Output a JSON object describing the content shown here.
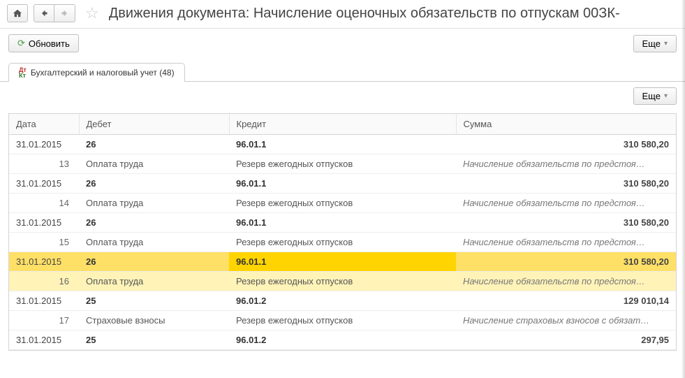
{
  "header": {
    "title": "Движения документа: Начисление оценочных обязательств по отпускам 00ЗК-"
  },
  "toolbar": {
    "refresh_label": "Обновить",
    "more_label": "Еще"
  },
  "tabs": {
    "accounting_label": "Бухгалтерский и налоговый учет (48)"
  },
  "sub_toolbar": {
    "more_label": "Еще"
  },
  "table": {
    "columns": {
      "date": "Дата",
      "debit": "Дебет",
      "credit": "Кредит",
      "sum": "Сумма"
    },
    "rows": [
      {
        "date": "31.01.2015",
        "debit": "26",
        "credit": "96.01.1",
        "sum": "310 580,20",
        "seq": "13",
        "debit_desc": "Оплата труда",
        "credit_desc": "Резерв ежегодных отпусков",
        "note": "Начисление обязательств по предстоя…",
        "selected": false
      },
      {
        "date": "31.01.2015",
        "debit": "26",
        "credit": "96.01.1",
        "sum": "310 580,20",
        "seq": "14",
        "debit_desc": "Оплата труда",
        "credit_desc": "Резерв ежегодных отпусков",
        "note": "Начисление обязательств по предстоя…",
        "selected": false
      },
      {
        "date": "31.01.2015",
        "debit": "26",
        "credit": "96.01.1",
        "sum": "310 580,20",
        "seq": "15",
        "debit_desc": "Оплата труда",
        "credit_desc": "Резерв ежегодных отпусков",
        "note": "Начисление обязательств по предстоя…",
        "selected": false
      },
      {
        "date": "31.01.2015",
        "debit": "26",
        "credit": "96.01.1",
        "sum": "310 580,20",
        "seq": "16",
        "debit_desc": "Оплата труда",
        "credit_desc": "Резерв ежегодных отпусков",
        "note": "Начисление обязательств по предстоя…",
        "selected": true
      },
      {
        "date": "31.01.2015",
        "debit": "25",
        "credit": "96.01.2",
        "sum": "129 010,14",
        "seq": "17",
        "debit_desc": "Страховые взносы",
        "credit_desc": "Резерв ежегодных отпусков",
        "note": "Начисление страховых взносов с обязат…",
        "selected": false
      },
      {
        "date": "31.01.2015",
        "debit": "25",
        "credit": "96.01.2",
        "sum": "297,95",
        "seq": "",
        "debit_desc": "",
        "credit_desc": "",
        "note": "",
        "selected": false
      }
    ]
  }
}
